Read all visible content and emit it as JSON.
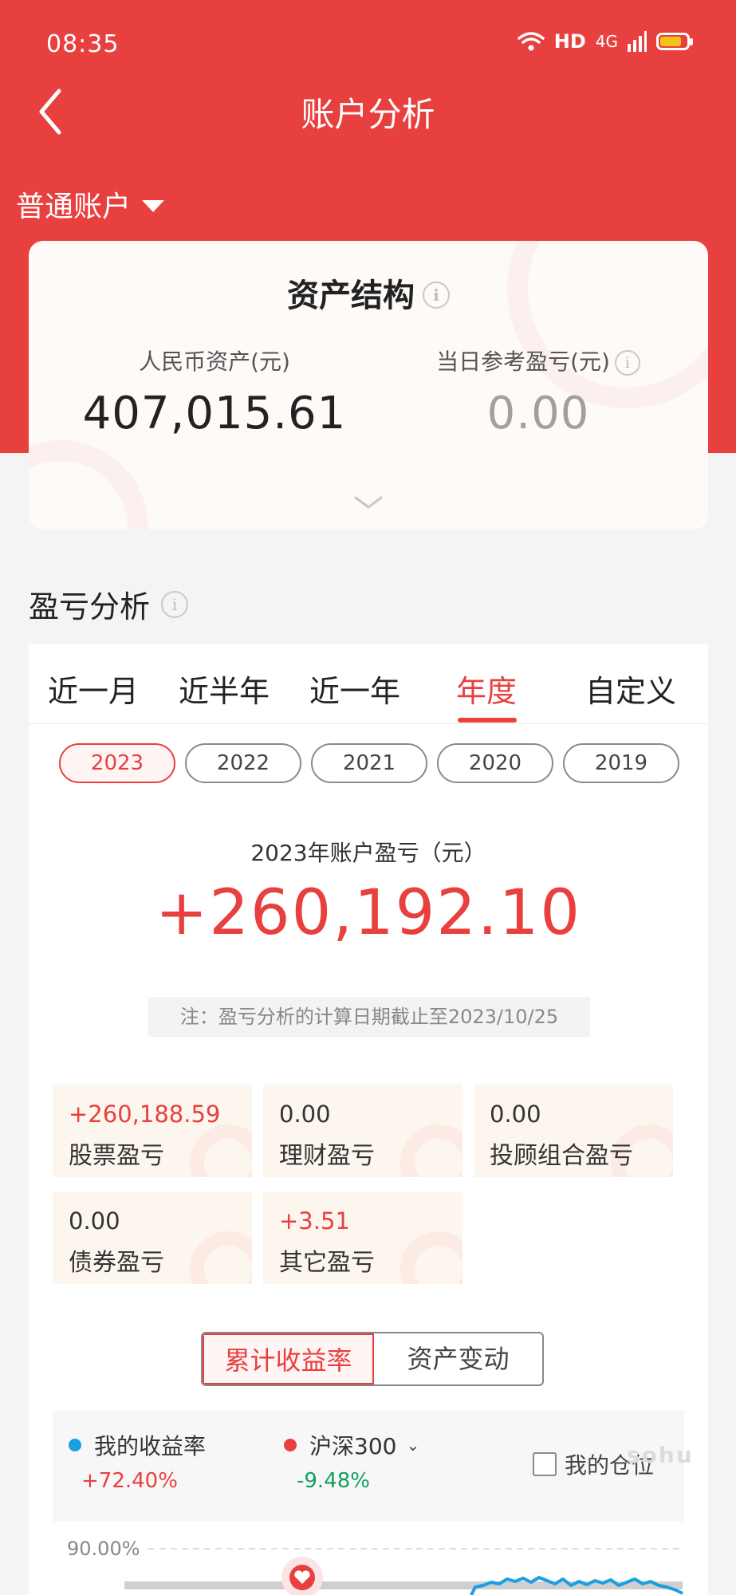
{
  "status_bar": {
    "time": "08:35",
    "network": "HD",
    "signal": "4G"
  },
  "header": {
    "title": "账户分析",
    "back_icon": "chevron-left-icon"
  },
  "account_selector": {
    "label": "普通账户"
  },
  "asset_card": {
    "title": "资产结构",
    "rmb_assets_label": "人民币资产(元)",
    "rmb_assets_value": "407,015.61",
    "daily_pl_label": "当日参考盈亏(元)",
    "daily_pl_value": "0.00"
  },
  "pl_section": {
    "title": "盈亏分析",
    "period_tabs": [
      {
        "label": "近一月",
        "active": false
      },
      {
        "label": "近半年",
        "active": false
      },
      {
        "label": "近一年",
        "active": false
      },
      {
        "label": "年度",
        "active": true
      },
      {
        "label": "自定义",
        "active": false
      }
    ],
    "years": [
      {
        "label": "2023",
        "active": true
      },
      {
        "label": "2022",
        "active": false
      },
      {
        "label": "2021",
        "active": false
      },
      {
        "label": "2020",
        "active": false
      },
      {
        "label": "2019",
        "active": false
      }
    ],
    "year_pl_label": "2023年账户盈亏（元）",
    "year_pl_value": "+260,192.10",
    "note": "注：盈亏分析的计算日期截止至2023/10/25",
    "breakdown": [
      {
        "value": "+260,188.59",
        "name": "股票盈亏",
        "positive": true
      },
      {
        "value": "0.00",
        "name": "理财盈亏",
        "positive": false
      },
      {
        "value": "0.00",
        "name": "投顾组合盈亏",
        "positive": false
      },
      {
        "value": "0.00",
        "name": "债券盈亏",
        "positive": false
      },
      {
        "value": "+3.51",
        "name": "其它盈亏",
        "positive": true
      }
    ]
  },
  "chart_toggle": {
    "left": "累计收益率",
    "right": "资产变动",
    "active": "left"
  },
  "chart_legend": {
    "mine": {
      "name": "我的收益率",
      "value": "+72.40%",
      "color": "#1a9fe0"
    },
    "index": {
      "name": "沪深300",
      "value": "-9.48%",
      "color": "#e8403e"
    },
    "position_label": "我的仓位",
    "watermark": "sohu"
  },
  "chart_data": {
    "type": "line",
    "y_tick_top": "90.00%",
    "series": [
      {
        "name": "我的收益率",
        "final_value": "+72.40%",
        "color": "#1a9fe0"
      },
      {
        "name": "沪深300",
        "final_value": "-9.48%",
        "color": "#e8403e"
      }
    ]
  },
  "colors": {
    "brand_red": "#e8403e",
    "positive_red": "#e8403e",
    "negative_green": "#12a05c",
    "accent_blue": "#1a9fe0"
  }
}
